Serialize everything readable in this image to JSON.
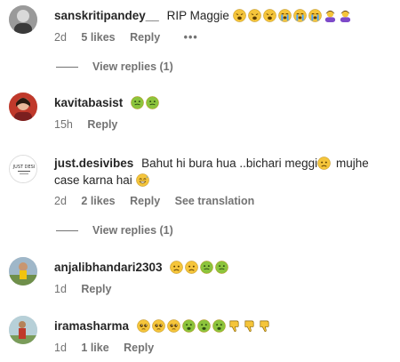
{
  "comments": [
    {
      "username": "sanskritipandey__",
      "text": "RIP Maggie",
      "text_after": "",
      "emojis_inline": [],
      "emojis": [
        "weary-face",
        "weary-face",
        "weary-face",
        "loudly-crying-face",
        "loudly-crying-face",
        "loudly-crying-face",
        "person-bowing",
        "person-bowing"
      ],
      "time": "2d",
      "likes": "5 likes",
      "reply": "Reply",
      "more": "•••",
      "view_replies": "View replies (1)"
    },
    {
      "username": "kavitabasist",
      "text": "",
      "emojis": [
        "nauseated-face",
        "nauseated-face"
      ],
      "time": "15h",
      "reply": "Reply"
    },
    {
      "username": "just.desivibes",
      "text": "Bahut hi bura hua ..bichari meggi",
      "text_mid": "mujhe case karna hai",
      "emoji_mid": "worried-face",
      "emoji_end": "grinning-sweat-face",
      "avatar_text": "JUST DESI",
      "time": "2d",
      "likes": "2 likes",
      "reply": "Reply",
      "translation": "See translation",
      "view_replies": "View replies (1)"
    },
    {
      "username": "anjalibhandari2303",
      "text": "",
      "emojis": [
        "worried-face",
        "worried-face",
        "nauseated-face",
        "nauseated-face"
      ],
      "time": "1d",
      "reply": "Reply"
    },
    {
      "username": "iramasharma",
      "text": "",
      "emojis": [
        "pleading-face",
        "pleading-face",
        "pleading-face",
        "sick-face",
        "sick-face",
        "sick-face",
        "thumbs-down",
        "thumbs-down",
        "thumbs-down"
      ],
      "time": "1d",
      "likes": "1 like",
      "reply": "Reply"
    }
  ],
  "colors": {
    "text": "#262626",
    "muted": "#737373",
    "emoji_yellow": "#f5c53b",
    "emoji_green": "#8cc43c"
  }
}
